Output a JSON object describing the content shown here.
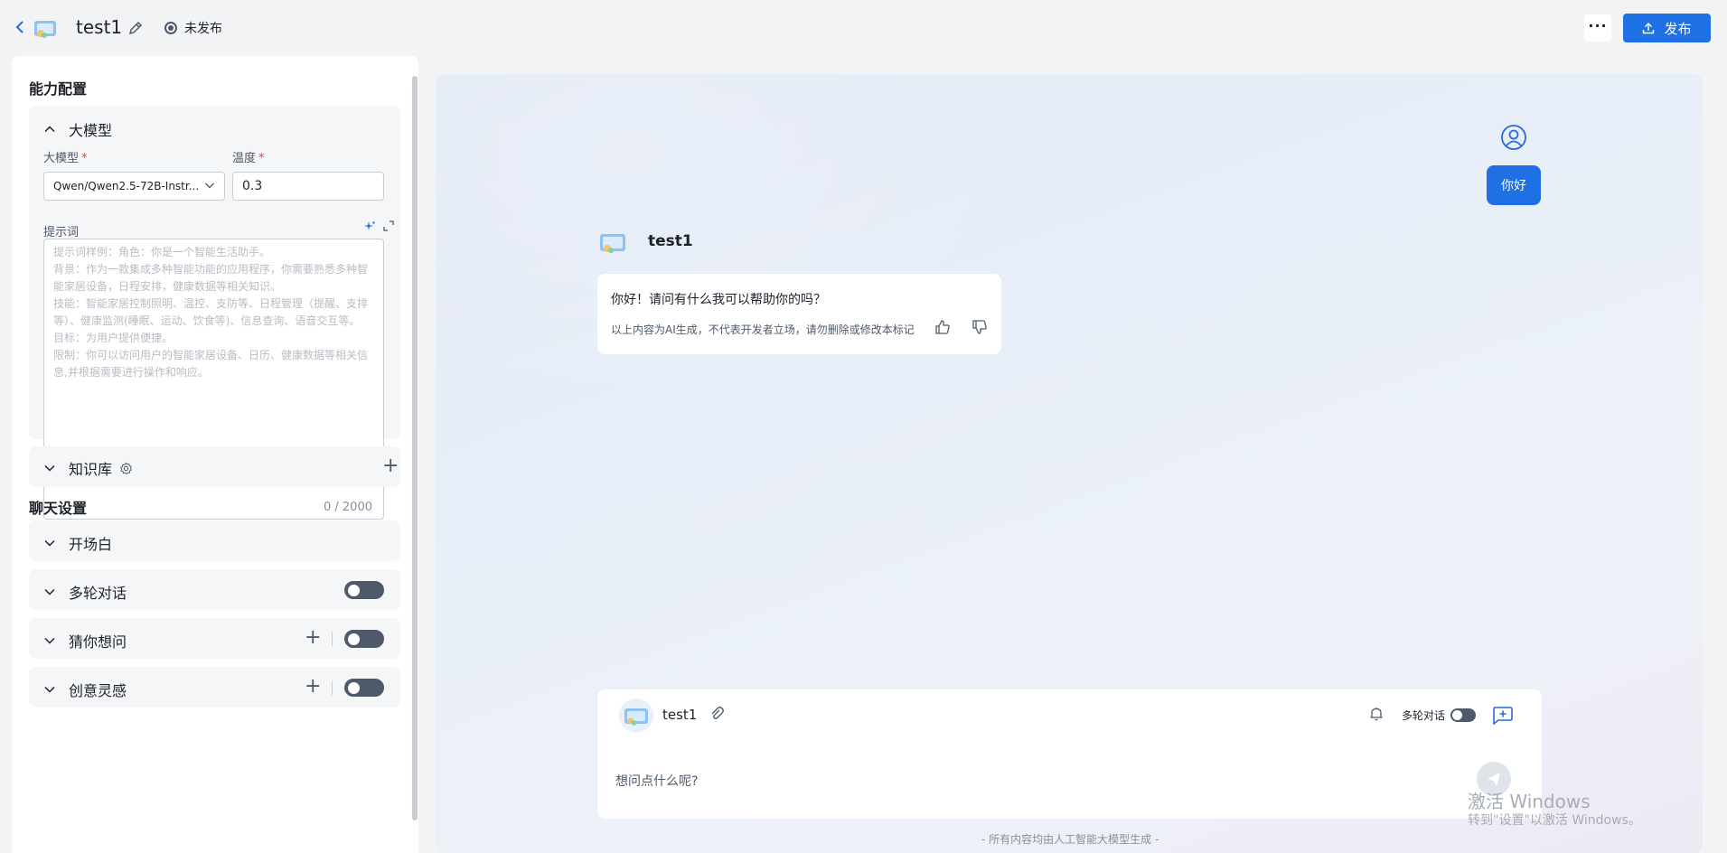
{
  "header": {
    "app_name": "test1",
    "status": "未发布",
    "more": "···",
    "publish_label": "发布"
  },
  "left": {
    "ability_title": "能力配置",
    "llm": {
      "title": "大模型",
      "model_label": "大模型",
      "model_value": "Qwen/Qwen2.5-72B-Instr...",
      "temp_label": "温度",
      "temp_value": "0.3",
      "prompt_label": "提示词",
      "prompt_placeholder_lines": [
        "提示词样例：角色：你是一个智能生活助手。",
        "背景：作为一款集成多种智能功能的应用程序，你需要熟悉多种智",
        "能家居设备，日程安排，健康数据等相关知识。",
        "技能：智能家居控制照明、温控、支防等、日程管理（提醒、支排",
        "等）、健康监测(睡眠、运动、饮食等)、信息查询、语音交互等。",
        "目标：为用户提供便捷。",
        "限制：你可以访问用户的智能家居设备、日历、健康数据等相关信",
        "息,并根据需要进行操作和响应。"
      ],
      "prompt_count": "0 / 2000"
    },
    "knowledge": {
      "title": "知识库"
    },
    "chat_title": "聊天设置",
    "opening": {
      "title": "开场白"
    },
    "multi_turn": {
      "title": "多轮对话"
    },
    "guess": {
      "title": "猜你想问"
    },
    "inspire": {
      "title": "创意灵感"
    }
  },
  "preview": {
    "user_message": "你好",
    "bot_name": "test1",
    "bot_message": "你好！请问有什么我可以帮助你的吗？",
    "bot_disclaimer": "以上内容为AI生成，不代表开发者立场，请勿删除或修改本标记",
    "composer": {
      "bot_name": "test1",
      "multi_turn_label": "多轮对话",
      "placeholder": "想问点什么呢?"
    },
    "footer_note": "- 所有内容均由人工智能大模型生成 -"
  },
  "watermark": {
    "line1": "激活 Windows",
    "line2": "转到\"设置\"以激活 Windows。"
  },
  "colors": {
    "accent": "#1f6fe5",
    "toggle_off": "#4e5969",
    "required": "#e03e3e"
  }
}
